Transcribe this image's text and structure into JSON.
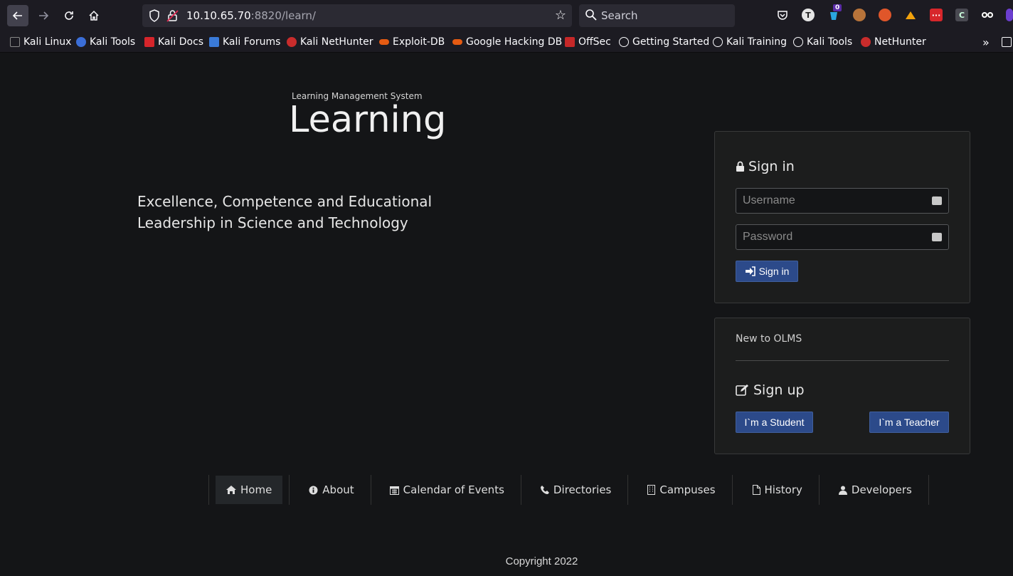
{
  "browser": {
    "url_host": "10.10.65.70",
    "url_rest": ":8820/learn/",
    "search_placeholder": "Search",
    "ext_badge": "0",
    "bookmarks": [
      {
        "label": "Kali Linux",
        "color": "#367bf0"
      },
      {
        "label": "Kali Tools",
        "color": "#3b6ed8"
      },
      {
        "label": "Kali Docs",
        "color": "#d6252b"
      },
      {
        "label": "Kali Forums",
        "color": "#3a7ad8"
      },
      {
        "label": "Kali NetHunter",
        "color": "#c92c2c"
      },
      {
        "label": "Exploit-DB",
        "color": "#e55b12"
      },
      {
        "label": "Google Hacking DB",
        "color": "#e55b12"
      },
      {
        "label": "OffSec",
        "color": "#c62828"
      },
      {
        "label": "Getting Started",
        "color": "globe"
      },
      {
        "label": "Kali Training",
        "color": "globe"
      },
      {
        "label": "Kali Tools",
        "color": "globe"
      },
      {
        "label": "NetHunter",
        "color": "#c92c2c"
      }
    ]
  },
  "brand": {
    "subtitle": "Learning Management System",
    "title": "Learning"
  },
  "tagline": "Excellence, Competence and Educational Leadership in Science and Technology",
  "signin": {
    "heading": "Sign in",
    "username_placeholder": "Username",
    "password_placeholder": "Password",
    "button": "Sign in"
  },
  "signup": {
    "new_to": "New to OLMS",
    "heading": "Sign up",
    "student_button": "I`m a Student",
    "teacher_button": "I`m a Teacher"
  },
  "nav": [
    {
      "label": "Home",
      "icon": "home-icon"
    },
    {
      "label": "About",
      "icon": "info-icon"
    },
    {
      "label": "Calendar of Events",
      "icon": "calendar-icon"
    },
    {
      "label": "Directories",
      "icon": "phone-icon"
    },
    {
      "label": "Campuses",
      "icon": "building-icon"
    },
    {
      "label": "History",
      "icon": "file-icon"
    },
    {
      "label": "Developers",
      "icon": "user-icon"
    }
  ],
  "footer": {
    "copyright": "Copyright 2022"
  },
  "colors": {
    "accent_button": "#2c4a8a",
    "page_bg": "#141517",
    "panel_bg": "#1c1d1d"
  }
}
